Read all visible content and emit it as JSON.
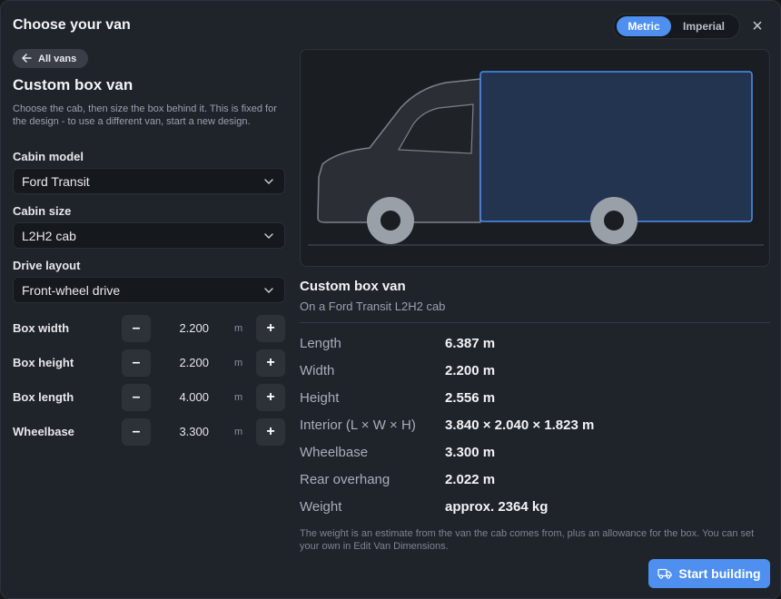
{
  "header": {
    "title": "Choose your van",
    "units": {
      "metric": "Metric",
      "imperial": "Imperial",
      "selected": "Metric"
    },
    "close_icon": "×"
  },
  "sidebar": {
    "back_label": "All vans",
    "heading": "Custom box van",
    "description": "Choose the cab, then size the box behind it. This is fixed for the design - to use a different van, start a new design.",
    "cabin_model": {
      "label": "Cabin model",
      "value": "Ford Transit"
    },
    "cabin_size": {
      "label": "Cabin size",
      "value": "L2H2 cab"
    },
    "drive_layout": {
      "label": "Drive layout",
      "value": "Front-wheel drive"
    },
    "dimensions": [
      {
        "label": "Box width",
        "value": "2.200",
        "unit": "m",
        "minus": "–",
        "plus": "+"
      },
      {
        "label": "Box height",
        "value": "2.200",
        "unit": "m",
        "minus": "–",
        "plus": "+"
      },
      {
        "label": "Box length",
        "value": "4.000",
        "unit": "m",
        "minus": "–",
        "plus": "+"
      },
      {
        "label": "Wheelbase",
        "value": "3.300",
        "unit": "m",
        "minus": "–",
        "plus": "+"
      }
    ]
  },
  "summary": {
    "title": "Custom box van",
    "subtitle": "On a Ford Transit L2H2 cab",
    "specs": [
      {
        "key": "Length",
        "value": "6.387 m"
      },
      {
        "key": "Width",
        "value": "2.200 m"
      },
      {
        "key": "Height",
        "value": "2.556 m"
      },
      {
        "key": "Interior (L × W × H)",
        "value": "3.840 × 2.040 × 1.823 m"
      },
      {
        "key": "Wheelbase",
        "value": "3.300 m"
      },
      {
        "key": "Rear overhang",
        "value": "2.022 m"
      },
      {
        "key": "Weight",
        "value": "approx. 2364 kg"
      }
    ],
    "note": "The weight is an estimate from the van the cab comes from, plus an allowance for the box. You can set your own in Edit Van Dimensions."
  },
  "footer": {
    "start_label": "Start building"
  },
  "colors": {
    "accent": "#4e8ff0",
    "box_fill": "#223450",
    "box_stroke": "#4e8ff0",
    "wheel": "#9aa0a8"
  }
}
